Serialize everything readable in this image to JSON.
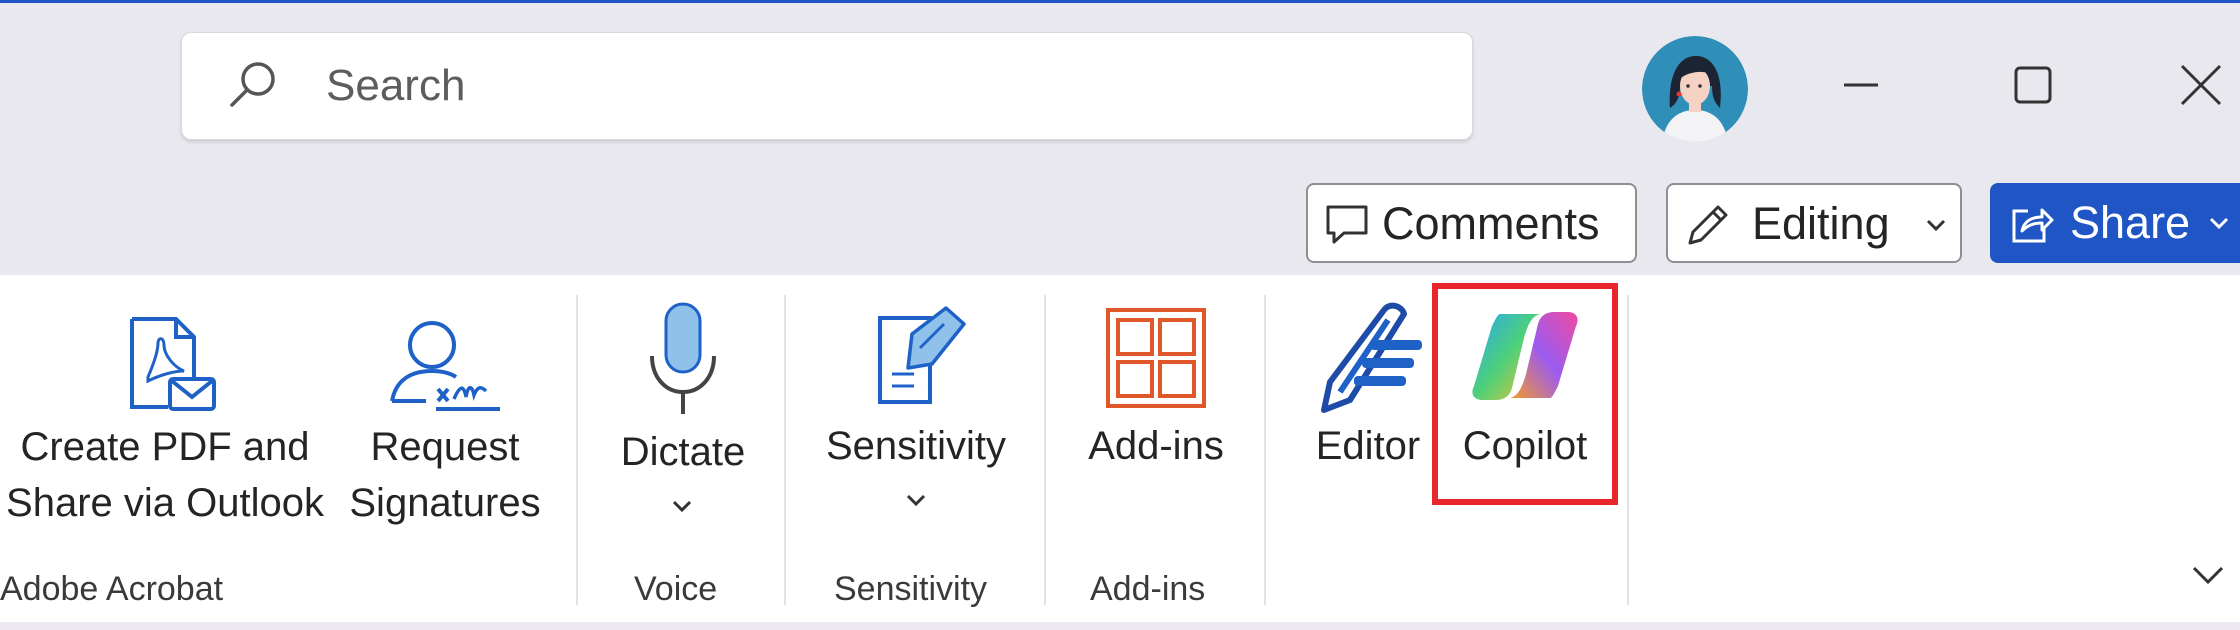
{
  "search": {
    "placeholder": "Search"
  },
  "title_buttons": {
    "minimize": "minimize-icon",
    "maximize": "maximize-icon",
    "close": "close-icon"
  },
  "command_bar": {
    "comments": "Comments",
    "editing": "Editing",
    "share": "Share"
  },
  "ribbon": {
    "groups": [
      {
        "name": "Adobe Acrobat",
        "buttons": [
          {
            "line1": "Create PDF and",
            "line2": "Share via Outlook",
            "icon": "pdf-mail-icon"
          },
          {
            "line1": "Request",
            "line2": "Signatures",
            "icon": "signature-icon"
          }
        ]
      },
      {
        "name": "Voice",
        "buttons": [
          {
            "label": "Dictate",
            "icon": "microphone-icon",
            "has_dropdown": true
          }
        ]
      },
      {
        "name": "Sensitivity",
        "buttons": [
          {
            "label": "Sensitivity",
            "icon": "sensitivity-label-icon",
            "has_dropdown": true
          }
        ]
      },
      {
        "name": "Add-ins",
        "buttons": [
          {
            "label": "Add-ins",
            "icon": "add-ins-grid-icon"
          }
        ]
      },
      {
        "name": "",
        "buttons": [
          {
            "label": "Editor",
            "icon": "editor-pen-icon"
          },
          {
            "label": "Copilot",
            "icon": "copilot-icon",
            "highlighted": true
          }
        ]
      }
    ]
  },
  "colors": {
    "accent": "#1e56c8",
    "share_bg": "#1f55c5",
    "highlight": "#e8262b",
    "titlebar_bg": "#e9e8ee",
    "ribbon_bg": "#ffffff"
  }
}
